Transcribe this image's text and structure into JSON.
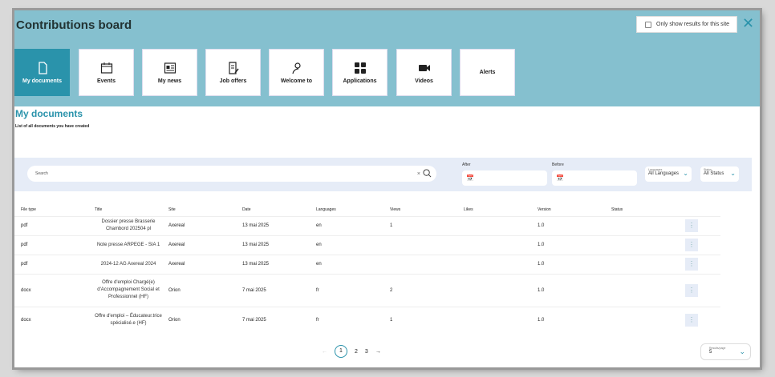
{
  "header": {
    "title": "Contributions board",
    "only_site_label": "Only show results for this site",
    "only_site_checked": false,
    "accent": "#2a93ab",
    "band_color": "#85c0cf"
  },
  "tiles": [
    {
      "label": "My documents",
      "icon": "document-icon",
      "active": true
    },
    {
      "label": "Events",
      "icon": "calendar-icon"
    },
    {
      "label": "My news",
      "icon": "newspaper-icon"
    },
    {
      "label": "Job offers",
      "icon": "job-offer-icon"
    },
    {
      "label": "Welcome to",
      "icon": "person-icon"
    },
    {
      "label": "Applications",
      "icon": "grid-icon"
    },
    {
      "label": "Videos",
      "icon": "video-icon"
    },
    {
      "label": "Alerts",
      "icon": ""
    }
  ],
  "section": {
    "title": "My documents",
    "subtitle": "List of all documents you have created"
  },
  "filters": {
    "search_placeholder": "Search",
    "after_label": "After",
    "before_label": "Before",
    "languages_label": "Languages",
    "languages_value": "All Languages",
    "status_label": "Status",
    "status_value": "All Status"
  },
  "table": {
    "headers": [
      "File type",
      "Title",
      "Site",
      "Date",
      "Languages",
      "Views",
      "Likes",
      "Version",
      "Status"
    ],
    "rows": [
      [
        "pdf",
        "Dossier presse Brasserie Chambord 202504 pl",
        "Axereal",
        "13 mai 2025",
        "en",
        "1",
        "",
        "1.0",
        ""
      ],
      [
        "pdf",
        "Note presse ARPEGE - SIA 1",
        "Axereal",
        "13 mai 2025",
        "en",
        "",
        "",
        "1.0",
        ""
      ],
      [
        "pdf",
        "2024-12 AG Axereal 2024",
        "Axereal",
        "13 mai 2025",
        "en",
        "",
        "",
        "1.0",
        ""
      ],
      [
        "docx",
        "Offre d'emploi Chargé(e) d'Accompagnement Social et Professionnel (HF)",
        "Orion",
        "7 mai 2025",
        "fr",
        "2",
        "",
        "1.0",
        ""
      ],
      [
        "docx",
        "Offre d'emploi – Éducateur.trice spécialisé.e (HF)",
        "Orion",
        "7 mai 2025",
        "fr",
        "1",
        "",
        "1.0",
        ""
      ]
    ]
  },
  "pagination": {
    "pages": [
      "1",
      "2",
      "3"
    ],
    "current": "1",
    "results_per_page_label": "Results/page",
    "results_per_page": "5"
  }
}
